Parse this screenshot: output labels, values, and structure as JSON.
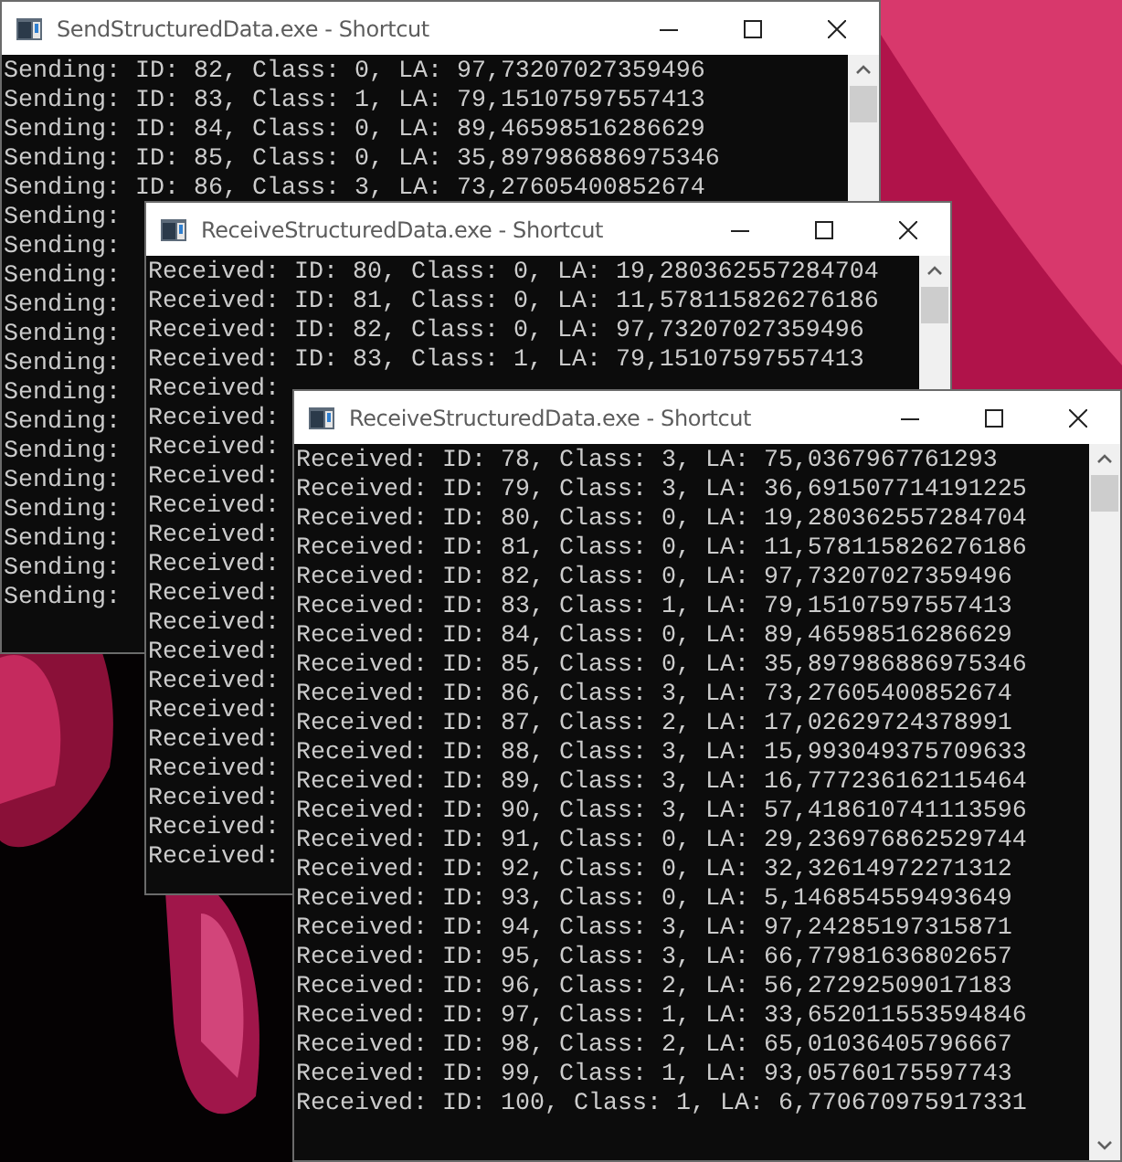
{
  "windows": [
    {
      "title": "SendStructuredData.exe - Shortcut",
      "lines": [
        "Sending: ID: 82, Class: 0, LA: 97,73207027359496",
        "Sending: ID: 83, Class: 1, LA: 79,15107597557413",
        "Sending: ID: 84, Class: 0, LA: 89,46598516286629",
        "Sending: ID: 85, Class: 0, LA: 35,897986886975346",
        "Sending: ID: 86, Class: 3, LA: 73,27605400852674",
        "Sending:",
        "Sending:",
        "Sending:",
        "Sending:",
        "Sending:",
        "Sending:",
        "Sending:",
        "Sending:",
        "Sending:",
        "Sending:",
        "Sending:",
        "Sending:",
        "Sending:",
        "Sending:"
      ]
    },
    {
      "title": "ReceiveStructuredData.exe - Shortcut",
      "lines": [
        "Received: ID: 80, Class: 0, LA: 19,280362557284704",
        "Received: ID: 81, Class: 0, LA: 11,578115826276186",
        "Received: ID: 82, Class: 0, LA: 97,73207027359496",
        "Received: ID: 83, Class: 1, LA: 79,15107597557413",
        "Received:",
        "Received:",
        "Received:",
        "Received:",
        "Received:",
        "Received:",
        "Received:",
        "Received:",
        "Received:",
        "Received:",
        "Received:",
        "Received:",
        "Received:",
        "Received:",
        "Received:",
        "Received:",
        "Received:"
      ]
    },
    {
      "title": "ReceiveStructuredData.exe - Shortcut",
      "lines": [
        "Received: ID: 78, Class: 3, LA: 75,0367967761293",
        "Received: ID: 79, Class: 3, LA: 36,691507714191225",
        "Received: ID: 80, Class: 0, LA: 19,280362557284704",
        "Received: ID: 81, Class: 0, LA: 11,578115826276186",
        "Received: ID: 82, Class: 0, LA: 97,73207027359496",
        "Received: ID: 83, Class: 1, LA: 79,15107597557413",
        "Received: ID: 84, Class: 0, LA: 89,46598516286629",
        "Received: ID: 85, Class: 0, LA: 35,897986886975346",
        "Received: ID: 86, Class: 3, LA: 73,27605400852674",
        "Received: ID: 87, Class: 2, LA: 17,02629724378991",
        "Received: ID: 88, Class: 3, LA: 15,993049375709633",
        "Received: ID: 89, Class: 3, LA: 16,777236162115464",
        "Received: ID: 90, Class: 3, LA: 57,418610741113596",
        "Received: ID: 91, Class: 0, LA: 29,236976862529744",
        "Received: ID: 92, Class: 0, LA: 32,32614972271312",
        "Received: ID: 93, Class: 0, LA: 5,146854559493649",
        "Received: ID: 94, Class: 3, LA: 97,24285197315871",
        "Received: ID: 95, Class: 3, LA: 66,77981636802657",
        "Received: ID: 96, Class: 2, LA: 56,27292509017183",
        "Received: ID: 97, Class: 1, LA: 33,652011553594846",
        "Received: ID: 98, Class: 2, LA: 65,01036405796667",
        "Received: ID: 99, Class: 1, LA: 93,05760175597743",
        "Received: ID: 100, Class: 1, LA: 6,770670975917331"
      ]
    }
  ]
}
